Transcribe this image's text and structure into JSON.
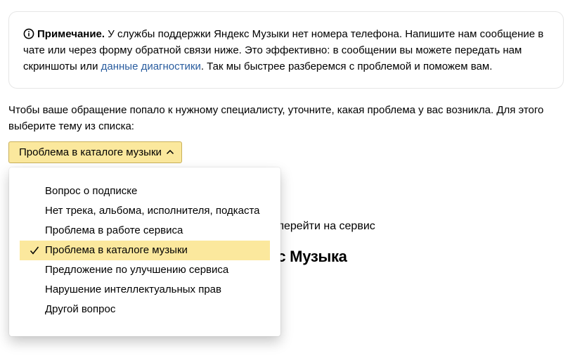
{
  "note": {
    "label": "Примечание.",
    "text_before_link": " У службы поддержки Яндекс Музыки нет номера телефона. Напишите нам сообщение в чате или через форму обратной связи ниже. Это эффективно: в сообщении вы можете передать нам скриншоты или ",
    "link_text": "данные диагностики",
    "text_after_link": ". Так мы быстрее разберемся с проблемой и поможем вам."
  },
  "intro": "Чтобы ваше обращение попало к нужному специалисту, уточните, какая проблема у вас возникла. Для этого выберите тему из списка:",
  "select": {
    "value": "Проблема в каталоге музыки"
  },
  "dropdown": {
    "options": [
      {
        "label": "Вопрос о подписке",
        "selected": false
      },
      {
        "label": "Нет трека, альбома, исполнителя, подкаста",
        "selected": false
      },
      {
        "label": "Проблема в работе сервиса",
        "selected": false
      },
      {
        "label": "Проблема в каталоге музыки",
        "selected": true
      },
      {
        "label": "Предложение по улучшению сервиса",
        "selected": false
      },
      {
        "label": "Нарушение интеллектуальных прав",
        "selected": false
      },
      {
        "label": "Другой вопрос",
        "selected": false
      }
    ]
  },
  "background": {
    "partial_line": "е перейти на сервис",
    "partial_heading": "кс Музыка"
  },
  "colors": {
    "accent_yellow": "#fbe89d",
    "link_blue": "#2a5d9f"
  },
  "icons": {
    "note": "info-circle-icon",
    "select": "chevron-up-icon",
    "selected_option": "checkmark-icon"
  }
}
